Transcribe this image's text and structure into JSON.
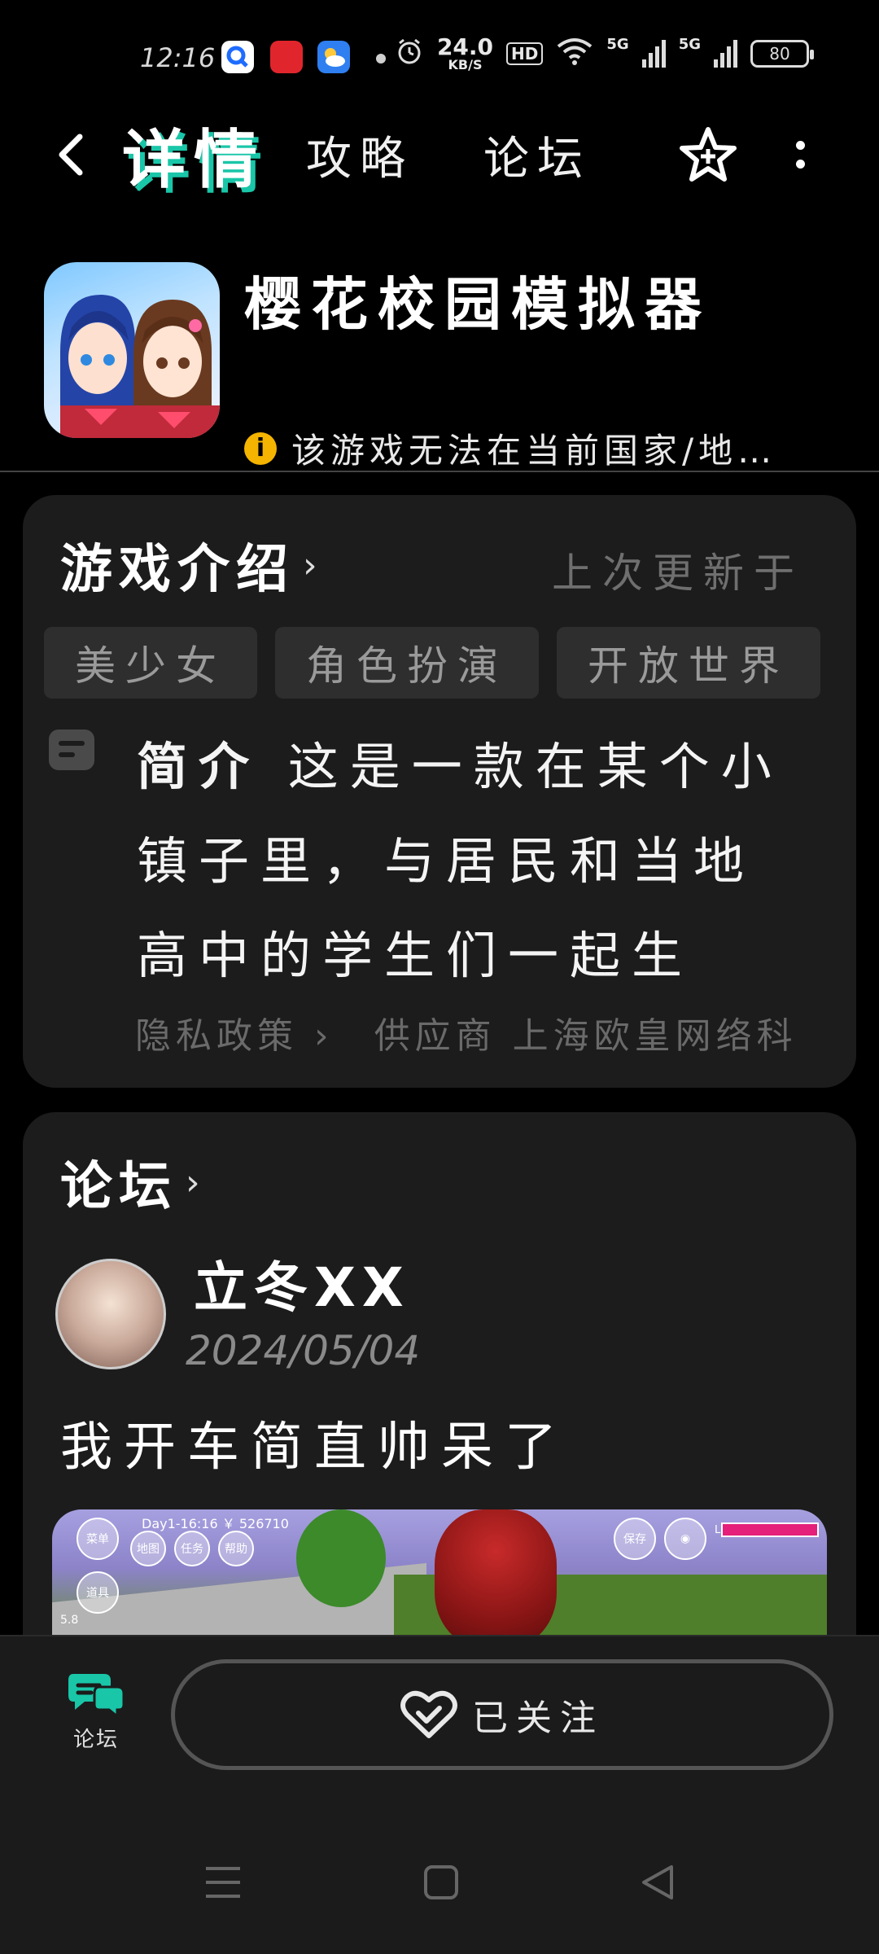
{
  "status_bar": {
    "time": "12:16",
    "speed_value": "24.0",
    "speed_unit": "KB/S",
    "hd": "HD",
    "net1": "5G",
    "net2": "5G",
    "battery": "80"
  },
  "header": {
    "tabs": [
      {
        "label": "详情",
        "active": true
      },
      {
        "label": "攻略",
        "active": false
      },
      {
        "label": "论坛",
        "active": false
      }
    ]
  },
  "game": {
    "title": "樱花校园模拟器",
    "notice": "该游戏无法在当前国家/地…"
  },
  "intro": {
    "title": "游戏介绍",
    "update_label": "上次更新于",
    "tags": [
      "美少女",
      "角色扮演",
      "开放世界"
    ],
    "desc_label": "简介",
    "desc_text": "这是一款在某个小镇子里，与居民和当地高中的学生们一起生活…",
    "privacy": "隐私政策",
    "supplier": "供应商 上海欧皇网络科"
  },
  "forum": {
    "title": "论坛",
    "post": {
      "username": "立冬XX",
      "date": "2024/05/04",
      "text": "我开车简直帅呆了",
      "image_hud": {
        "menu": "菜单",
        "map": "地图",
        "task": "任务",
        "help": "帮助",
        "item": "道具",
        "day": "Day1-16:16 ￥ 526710",
        "save": "保存",
        "life": "LIFE",
        "fps": "5.8"
      }
    }
  },
  "bottom": {
    "nav_forum_label": "论坛",
    "follow_label": "已关注"
  },
  "colors": {
    "accent": "#19c6a8",
    "background": "#000000",
    "card": "#1c1c1c",
    "warning": "#f5b400"
  }
}
